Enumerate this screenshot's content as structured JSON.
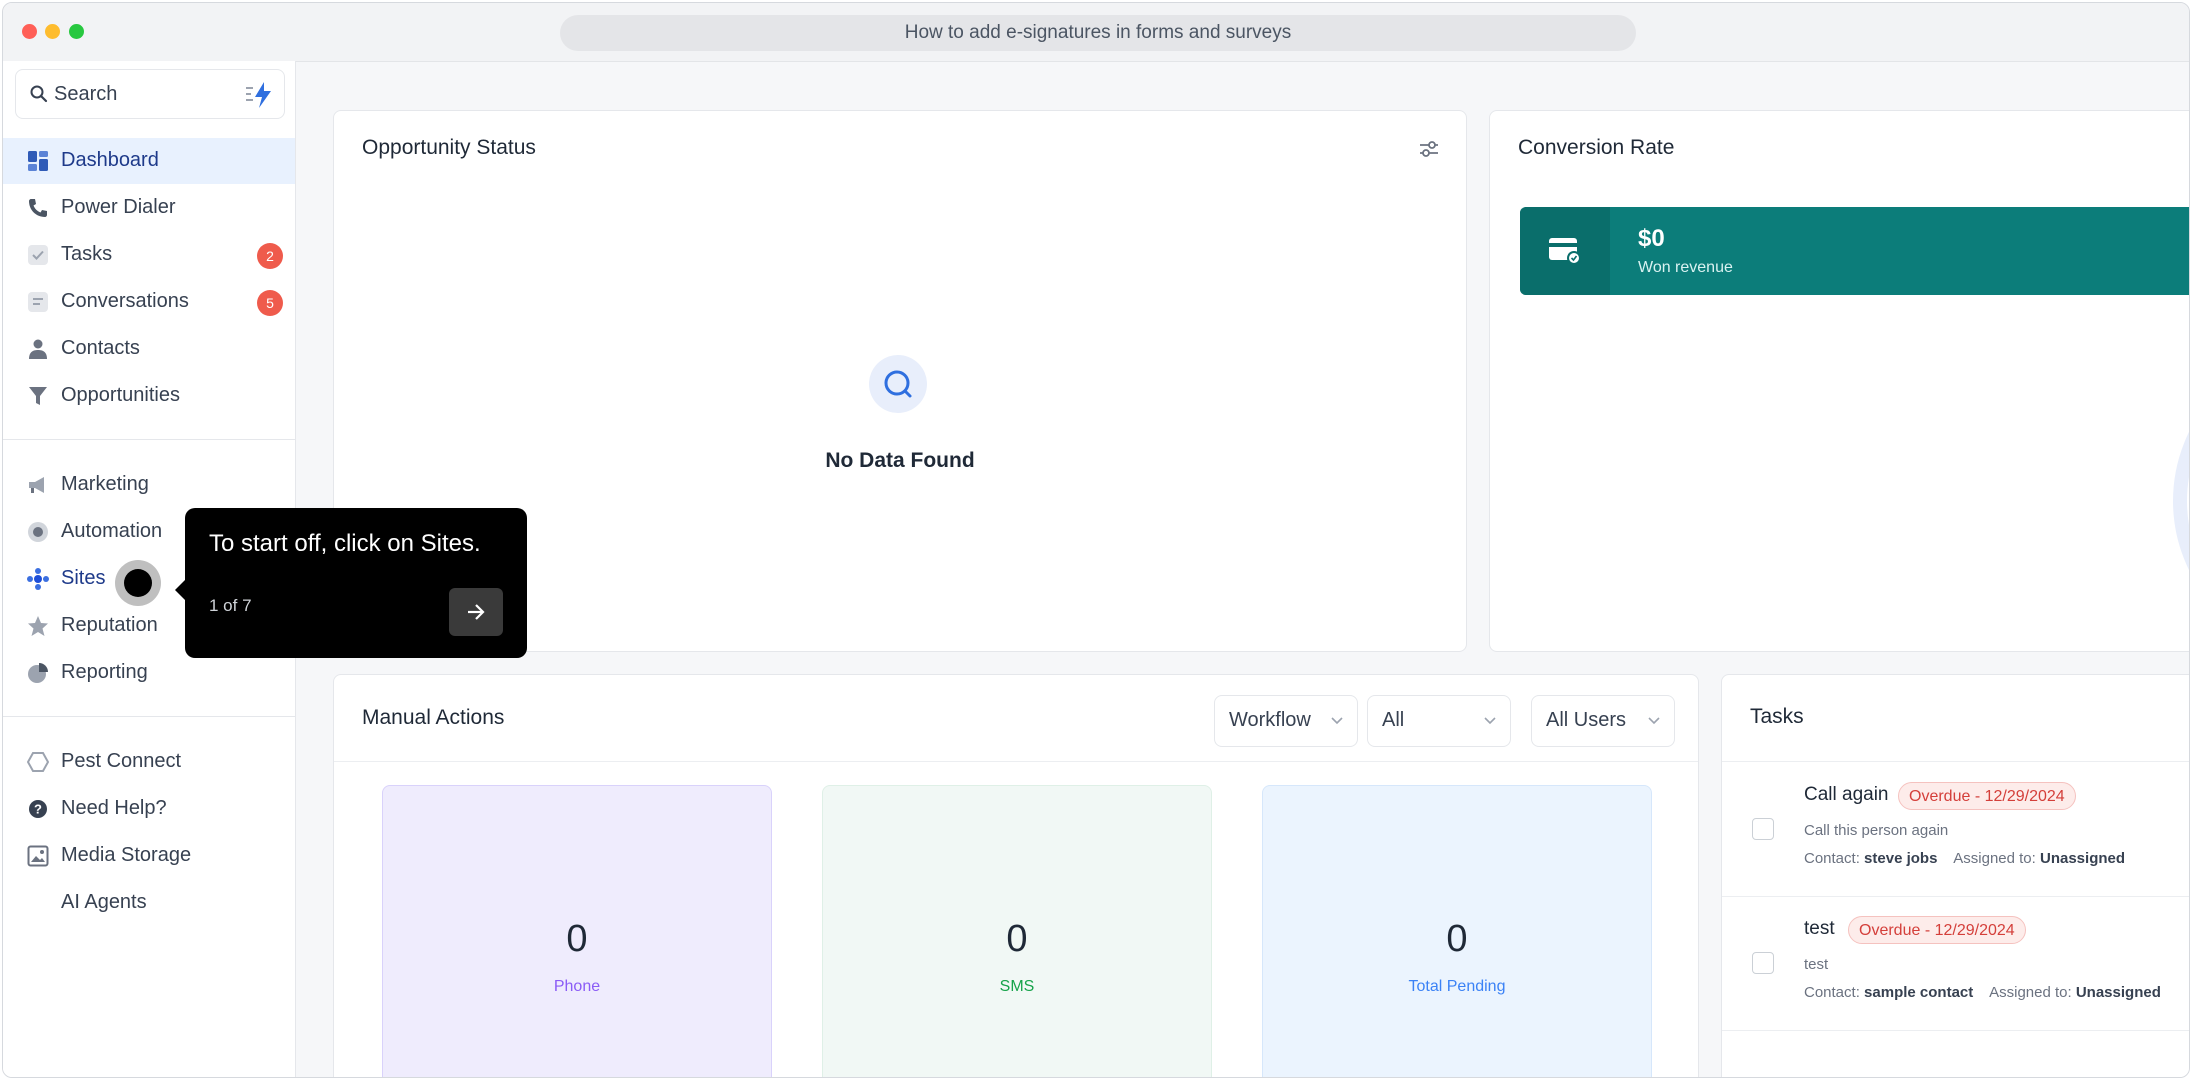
{
  "window": {
    "title": "How to add e-signatures in forms and surveys"
  },
  "sidebar": {
    "search_placeholder": "Search",
    "items": [
      {
        "label": "Dashboard",
        "icon": "dashboard-icon",
        "active": true
      },
      {
        "label": "Power Dialer",
        "icon": "phone-icon"
      },
      {
        "label": "Tasks",
        "icon": "check-icon",
        "badge": "2"
      },
      {
        "label": "Conversations",
        "icon": "chat-icon",
        "badge": "5"
      },
      {
        "label": "Contacts",
        "icon": "person-icon"
      },
      {
        "label": "Opportunities",
        "icon": "funnel-icon"
      },
      {
        "label": "Marketing",
        "icon": "megaphone-icon"
      },
      {
        "label": "Automation",
        "icon": "automation-icon"
      },
      {
        "label": "Sites",
        "icon": "globe-icon"
      },
      {
        "label": "Reputation",
        "icon": "star-icon"
      },
      {
        "label": "Reporting",
        "icon": "pie-chart-icon"
      },
      {
        "label": "Pest Connect",
        "icon": "hexagon-icon"
      },
      {
        "label": "Need Help?",
        "icon": "help-icon"
      },
      {
        "label": "Media Storage",
        "icon": "image-icon"
      },
      {
        "label": "AI Agents",
        "icon": ""
      }
    ]
  },
  "opportunity": {
    "title": "Opportunity Status",
    "empty_text": "No Data Found"
  },
  "conversion": {
    "title": "Conversion Rate",
    "won_value": "$0",
    "won_label": "Won revenue"
  },
  "manual_actions": {
    "title": "Manual Actions",
    "filters": [
      "Workflow",
      "All",
      "All Users"
    ],
    "stats": [
      {
        "value": "0",
        "label": "Phone",
        "color": "#8b5cf6"
      },
      {
        "value": "0",
        "label": "SMS",
        "color": "#16a34a"
      },
      {
        "value": "0",
        "label": "Total Pending",
        "color": "#3b82f6"
      }
    ]
  },
  "tasks": {
    "title": "Tasks",
    "items": [
      {
        "title": "Call again",
        "status": "Overdue - 12/29/2024",
        "description": "Call this person again",
        "contact_label": "Contact:",
        "contact": "steve jobs",
        "assigned_label": "Assigned to:",
        "assigned": "Unassigned"
      },
      {
        "title": "test",
        "status": "Overdue - 12/29/2024",
        "description": "test",
        "contact_label": "Contact:",
        "contact": "sample contact",
        "assigned_label": "Assigned to:",
        "assigned": "Unassigned"
      }
    ]
  },
  "tooltip": {
    "text": "To start off, click on Sites.",
    "step": "1 of 7"
  }
}
